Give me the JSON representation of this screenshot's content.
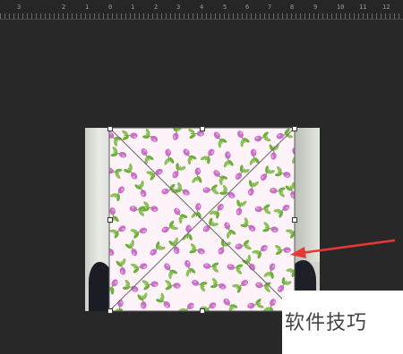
{
  "ruler": {
    "labels": [
      "3",
      "2",
      "1",
      "0",
      "1",
      "2",
      "3",
      "4",
      "5",
      "6",
      "7",
      "8",
      "9",
      "10",
      "11",
      "12",
      "13"
    ],
    "units": "inches"
  },
  "document": {
    "background_color": "#282828",
    "pattern_fill": {
      "motif": "pink rosebud floral",
      "background": "#fdf3f8",
      "flower_color": "#c86fc6",
      "leaf_color": "#6fae3b"
    },
    "transform_mode": "free-transform"
  },
  "annotation": {
    "arrow_color": "#e53935"
  },
  "watermark": {
    "text": "软件技巧"
  }
}
